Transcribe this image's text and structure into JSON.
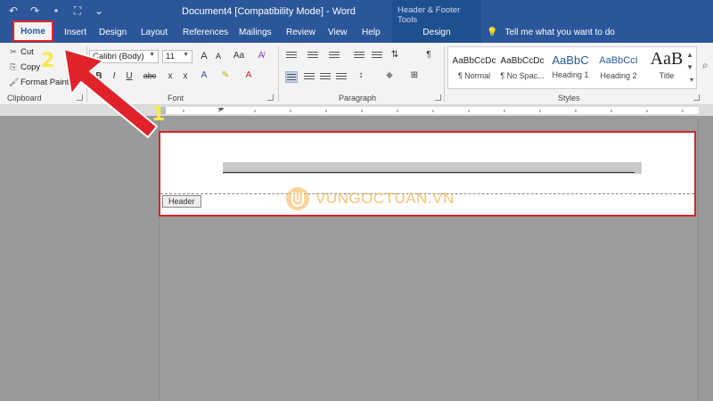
{
  "titlebar": {
    "document_title": "Document4 [Compatibility Mode] - Word",
    "context_group": "Header & Footer Tools",
    "qat_icons": [
      "undo-icon",
      "redo-icon",
      "bullet-dot-icon",
      "focus-frame-icon",
      "customize-qat-icon"
    ]
  },
  "tabs": {
    "home": "Home",
    "items": [
      "Insert",
      "Design",
      "Layout",
      "References",
      "Mailings",
      "Review",
      "View",
      "Help"
    ],
    "context_design": "Design",
    "tell_me": "Tell me what you want to do"
  },
  "clipboard": {
    "cut": "Cut",
    "copy": "Copy",
    "format_painter": "Format Painter",
    "label": "Clipboard"
  },
  "font": {
    "name": "Calibri (Body)",
    "size": "11",
    "grow": "A",
    "shrink": "A",
    "case": "Aa",
    "bold": "B",
    "italic": "I",
    "underline": "U",
    "strike": "abc",
    "subscript": "x",
    "superscript": "x",
    "label": "Font"
  },
  "paragraph": {
    "label": "Paragraph",
    "pilcrow": "¶"
  },
  "styles": {
    "label": "Styles",
    "items": [
      {
        "sample": "AaBbCcDc",
        "name": "¶ Normal"
      },
      {
        "sample": "AaBbCcDc",
        "name": "¶ No Spac..."
      },
      {
        "sample": "AaBbC",
        "name": "Heading 1"
      },
      {
        "sample": "AaBbCcI",
        "name": "Heading 2"
      },
      {
        "sample": "AaB",
        "name": "Title"
      }
    ]
  },
  "document": {
    "header_tag": "Header",
    "watermark": "VUNGOCTUAN.VN"
  },
  "annotations": {
    "step1": "1",
    "step2": "2"
  },
  "colors": {
    "ribbon_blue": "#2b579a",
    "highlight_red": "#e0232a",
    "step_yellow": "#f6e94a"
  }
}
